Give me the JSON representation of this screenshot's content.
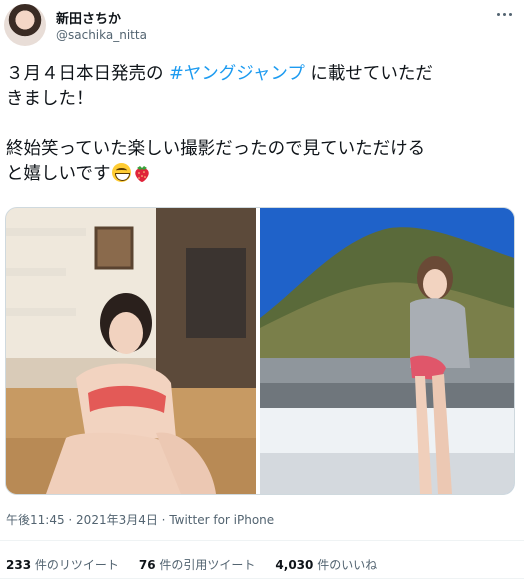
{
  "user": {
    "display_name": "新田さちか",
    "handle": "@sachika_nitta"
  },
  "tweet": {
    "line1_pre": "３月４日本日発売の ",
    "hashtag": "#ヤングジャンプ",
    "line1_post": " に載せていただ",
    "line2": "きました！",
    "line3": "終始笑っていた楽しい撮影だったので見ていただける",
    "line4": "と嬉しいです",
    "emojis": [
      "grinning-squinting-face-icon",
      "strawberry-icon"
    ]
  },
  "media": {
    "photos": [
      "photo-indoor-stairs",
      "photo-rooftop-hillside"
    ]
  },
  "meta": {
    "time": "午後11:45",
    "separator1": " · ",
    "date": "2021年3月4日",
    "separator2": " · ",
    "source": "Twitter for iPhone"
  },
  "stats": {
    "retweets_count": "233",
    "retweets_label": " 件のリツイート",
    "quotes_count": "76",
    "quotes_label": " 件の引用ツイート",
    "likes_count": "4,030",
    "likes_label": " 件のいいね"
  },
  "colors": {
    "hashtag": "#1d9bf0",
    "text": "#0f1419",
    "secondary": "#536471"
  }
}
